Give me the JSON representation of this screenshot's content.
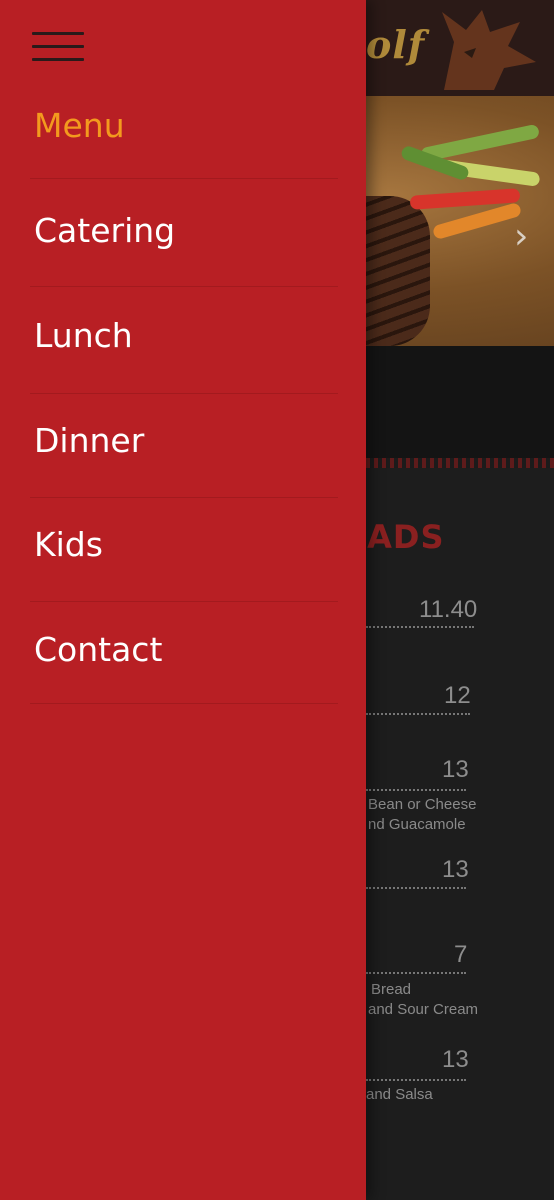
{
  "header": {
    "logo_text": "olf",
    "carousel_next_symbol": "›"
  },
  "background": {
    "section_title": "ALADS",
    "items": [
      {
        "price": "11.40"
      },
      {
        "price": "12"
      },
      {
        "price": "13",
        "desc_lines": [
          "Bean or Cheese",
          "nd Guacamole"
        ]
      },
      {
        "price": "13"
      },
      {
        "price": "7",
        "desc_lines": [
          "Bread",
          "and Sour Cream"
        ]
      },
      {
        "price": "13",
        "desc_lines": [
          "and Salsa"
        ]
      }
    ]
  },
  "drawer": {
    "menu_title": "Menu",
    "items": [
      {
        "label": "Catering"
      },
      {
        "label": "Lunch"
      },
      {
        "label": "Dinner"
      },
      {
        "label": "Kids"
      },
      {
        "label": "Contact"
      }
    ]
  },
  "colors": {
    "drawer_bg": "#b81f24",
    "menu_title": "#f39a1e",
    "nav_text": "#ffffff",
    "section_title": "#8a2020"
  }
}
